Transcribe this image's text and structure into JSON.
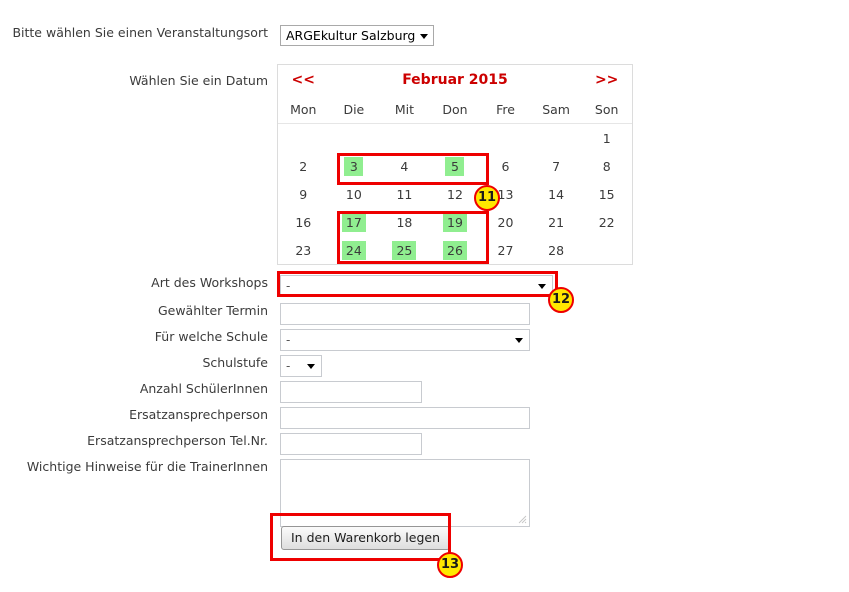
{
  "form": {
    "venue": {
      "label": "Bitte wählen Sie einen Veranstaltungsort",
      "value": "ARGEkultur Salzburg"
    },
    "date_picker": {
      "label": "Wählen Sie ein Datum"
    },
    "workshop_type": {
      "label": "Art des Workshops",
      "value": "-"
    },
    "chosen_date": {
      "label": "Gewählter Termin",
      "value": ""
    },
    "school": {
      "label": "Für welche Schule",
      "value": "-"
    },
    "school_level": {
      "label": "Schulstufe",
      "value": "-"
    },
    "student_count": {
      "label": "Anzahl SchülerInnen",
      "value": ""
    },
    "backup_contact": {
      "label": "Ersatzansprechperson",
      "value": ""
    },
    "backup_contact_phone": {
      "label": "Ersatzansprechperson Tel.Nr.",
      "value": ""
    },
    "trainer_notes": {
      "label": "Wichtige Hinweise für die TrainerInnen",
      "value": ""
    },
    "submit": {
      "label": "In den Warenkorb legen"
    }
  },
  "calendar": {
    "prev_label": "<<",
    "next_label": ">>",
    "title": "Februar 2015",
    "daynames": [
      "Mon",
      "Die",
      "Mit",
      "Don",
      "Fre",
      "Sam",
      "Son"
    ],
    "weeks": [
      [
        {
          "day": "",
          "available": false
        },
        {
          "day": "",
          "available": false
        },
        {
          "day": "",
          "available": false
        },
        {
          "day": "",
          "available": false
        },
        {
          "day": "",
          "available": false
        },
        {
          "day": "",
          "available": false
        },
        {
          "day": "1",
          "available": false
        }
      ],
      [
        {
          "day": "2",
          "available": false
        },
        {
          "day": "3",
          "available": true
        },
        {
          "day": "4",
          "available": false
        },
        {
          "day": "5",
          "available": true
        },
        {
          "day": "6",
          "available": false
        },
        {
          "day": "7",
          "available": false
        },
        {
          "day": "8",
          "available": false
        }
      ],
      [
        {
          "day": "9",
          "available": false
        },
        {
          "day": "10",
          "available": false
        },
        {
          "day": "11",
          "available": false
        },
        {
          "day": "12",
          "available": false
        },
        {
          "day": "13",
          "available": false
        },
        {
          "day": "14",
          "available": false
        },
        {
          "day": "15",
          "available": false
        }
      ],
      [
        {
          "day": "16",
          "available": false
        },
        {
          "day": "17",
          "available": true
        },
        {
          "day": "18",
          "available": false
        },
        {
          "day": "19",
          "available": true
        },
        {
          "day": "20",
          "available": false
        },
        {
          "day": "21",
          "available": false
        },
        {
          "day": "22",
          "available": false
        }
      ],
      [
        {
          "day": "23",
          "available": false
        },
        {
          "day": "24",
          "available": true
        },
        {
          "day": "25",
          "available": true
        },
        {
          "day": "26",
          "available": true
        },
        {
          "day": "27",
          "available": false
        },
        {
          "day": "28",
          "available": false
        },
        {
          "day": "",
          "available": false
        }
      ]
    ]
  },
  "annotations": {
    "badge_11": "11",
    "badge_12": "12",
    "badge_13": "13"
  },
  "colors": {
    "annotation_red": "#ee0000",
    "badge_yellow": "#ffe800",
    "available_green": "#90ee90",
    "calendar_header_red": "#cc0000"
  }
}
